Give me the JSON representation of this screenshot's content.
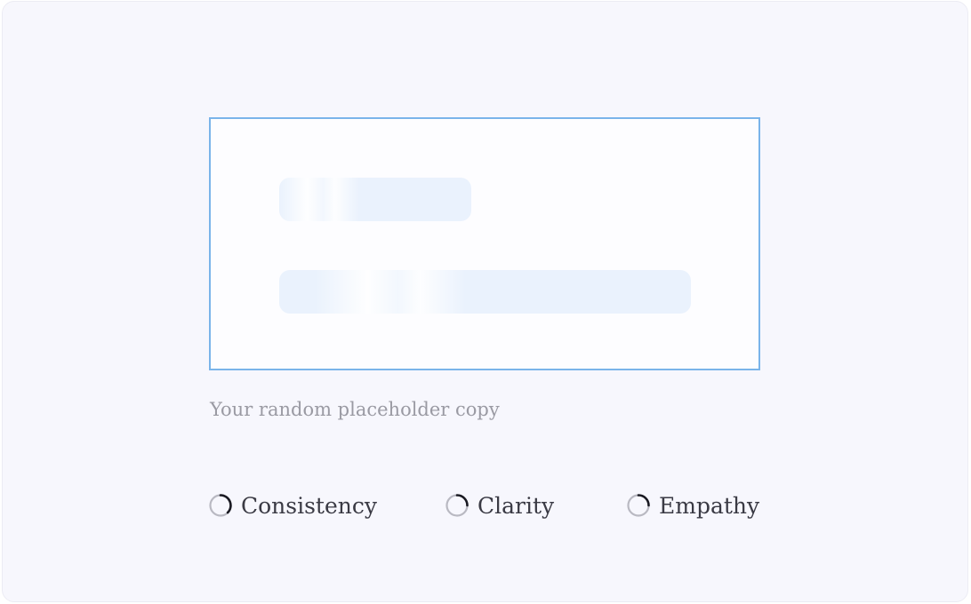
{
  "caption": "Your random placeholder copy",
  "loaders": [
    {
      "label": "Consistency"
    },
    {
      "label": "Clarity"
    },
    {
      "label": "Empathy"
    }
  ],
  "colors": {
    "background": "#f7f7fd",
    "card_border": "#7ab4ea",
    "skeleton": "#eaf2fd",
    "spinner_track": "#b9b9c2",
    "spinner_arc": "#1a1a22",
    "caption_text": "#9a9aa3",
    "label_text": "#3a3a44"
  },
  "icons": {
    "spinner": "loading-spinner-icon"
  }
}
